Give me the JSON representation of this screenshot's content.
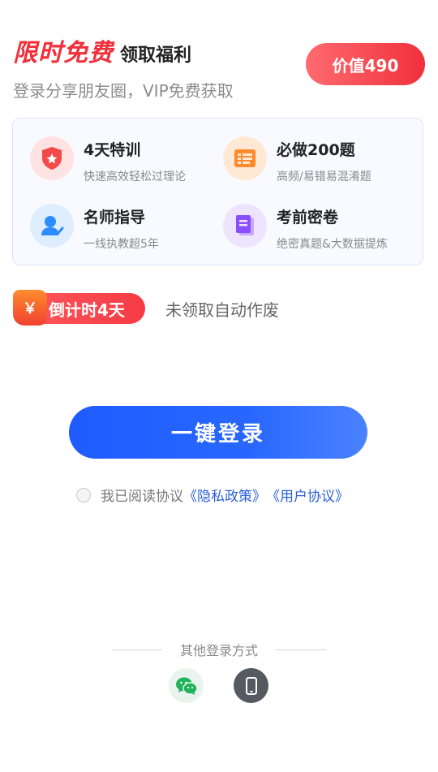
{
  "header": {
    "promo_title": "限时免费",
    "promo_subtitle": "领取福利",
    "promo_desc": "登录分享朋友圈，VIP免费获取",
    "value_badge": "价值490"
  },
  "benefits": [
    {
      "title": "4天特训",
      "desc": "快速高效轻松过理论",
      "icon": "shield-star-icon",
      "color": "#f24a4a"
    },
    {
      "title": "必做200题",
      "desc": "高频/易错易混淆题",
      "icon": "ticket-list-icon",
      "color": "#ff8a2b"
    },
    {
      "title": "名师指导",
      "desc": "一线执教超5年",
      "icon": "teacher-icon",
      "color": "#2d8cff"
    },
    {
      "title": "考前密卷",
      "desc": "绝密真题&大数据提炼",
      "icon": "exam-paper-icon",
      "color": "#8a4dff"
    }
  ],
  "countdown": {
    "yen_symbol": "￥",
    "label": "倒计时4天",
    "expire_note": "未领取自动作废"
  },
  "login": {
    "button_label": "一键登录"
  },
  "agreement": {
    "prefix": "我已阅读协议",
    "privacy_link": "《隐私政策》",
    "user_link": "《用户协议》"
  },
  "other_login": {
    "label": "其他登录方式",
    "methods": [
      "wechat-icon",
      "phone-icon"
    ]
  },
  "colors": {
    "accent_red": "#f0303a",
    "primary_blue": "#2563ff",
    "link_blue": "#2b5fd9"
  }
}
